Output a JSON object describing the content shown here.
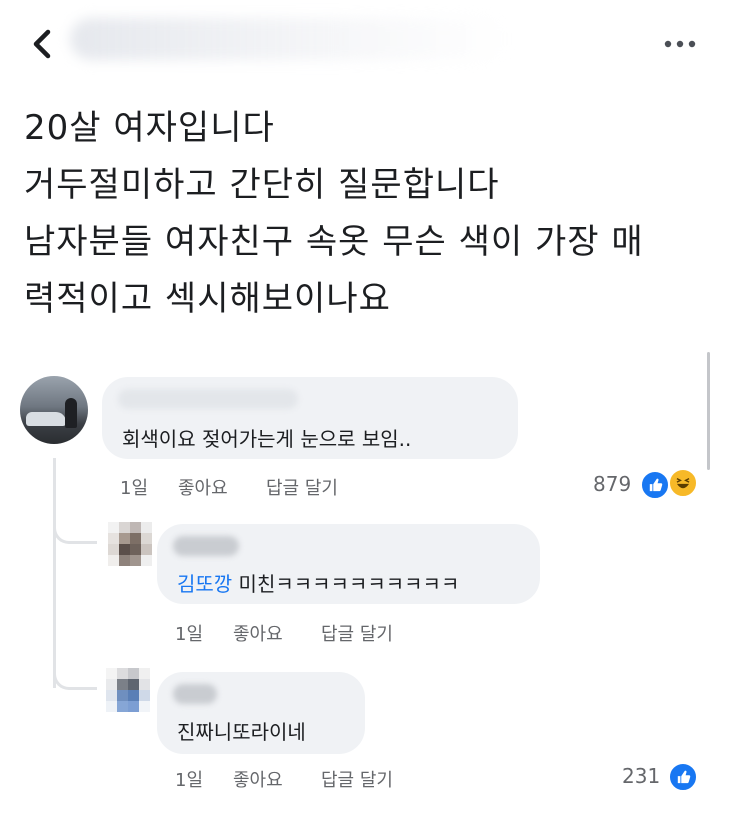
{
  "post": {
    "lines": [
      "20살 여자입니다",
      "거두절미하고 간단히 질문합니다",
      "남자분들 여자친구 속옷 무슨 색이 가장 매",
      "력적이고 섹시해보이나요"
    ]
  },
  "comments": [
    {
      "text": "회색이요 젖어가는게 눈으로 보임..",
      "time": "1일",
      "like_label": "좋아요",
      "reply_label": "답글 달기",
      "reaction_count": "879",
      "reactions": [
        "like-icon",
        "haha-icon"
      ]
    },
    {
      "mention": "김또깡",
      "text": " 미친ㅋㅋㅋㅋㅋㅋㅋㅋㅋㅋ",
      "time": "1일",
      "like_label": "좋아요",
      "reply_label": "답글 달기"
    },
    {
      "text": "진짜니또라이네",
      "time": "1일",
      "like_label": "좋아요",
      "reply_label": "답글 달기",
      "reaction_count": "231",
      "reactions": [
        "like-icon"
      ]
    }
  ],
  "colors": {
    "bubble": "#f0f2f5",
    "mention": "#1877f2",
    "meta": "#65676b",
    "like": "#1877f2",
    "haha": "#f7b928"
  }
}
